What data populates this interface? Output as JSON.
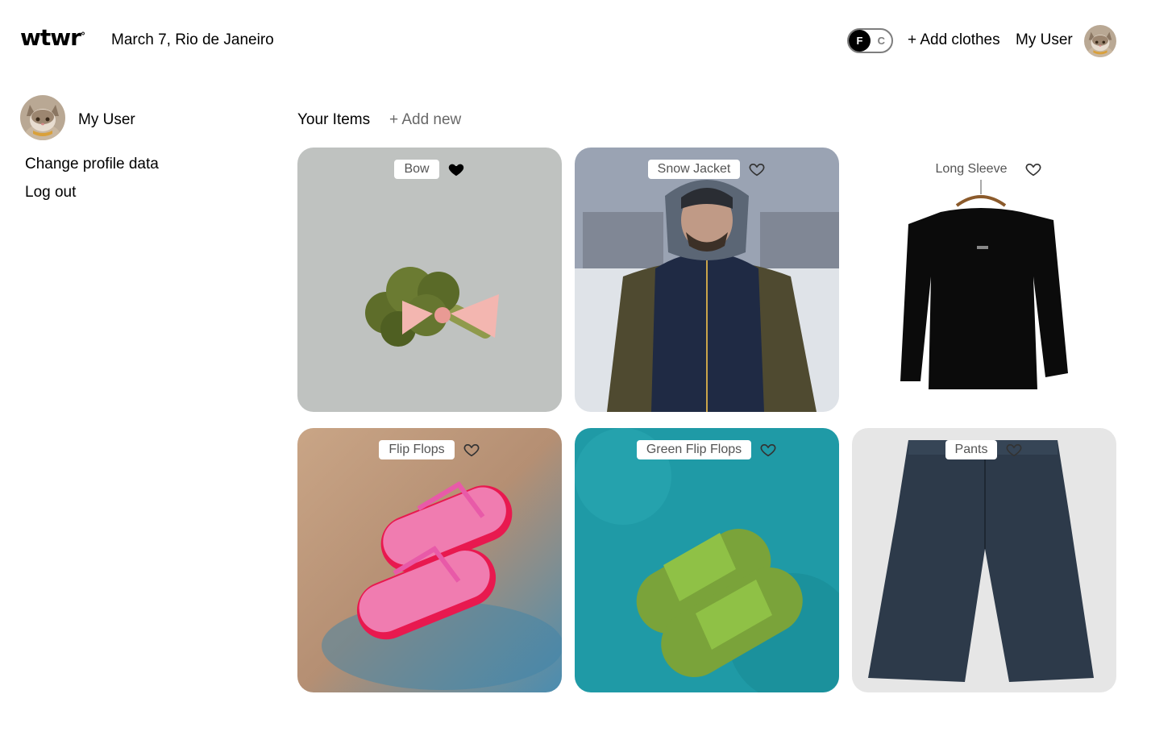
{
  "header": {
    "logo": "wtwr",
    "logo_mark": "°",
    "date_location": "March 7, Rio de Janeiro",
    "temp_toggle": {
      "active": "F",
      "inactive": "C"
    },
    "add_clothes_label": "+ Add clothes",
    "username": "My User"
  },
  "sidebar": {
    "username": "My User",
    "change_profile_label": "Change profile data",
    "logout_label": "Log out"
  },
  "items": {
    "title": "Your Items",
    "add_new_label": "+ Add new",
    "cards": [
      {
        "name": "Bow",
        "liked": true
      },
      {
        "name": "Snow Jacket",
        "liked": false
      },
      {
        "name": "Long Sleeve",
        "liked": false
      },
      {
        "name": "Flip Flops",
        "liked": false
      },
      {
        "name": "Green Flip Flops",
        "liked": false
      },
      {
        "name": "Pants",
        "liked": false
      }
    ]
  },
  "colors": {
    "text": "#000000",
    "muted": "#545454",
    "toggle_border": "#7e7e7e"
  },
  "icons": {
    "like_filled": "heart-filled-icon",
    "like_outline": "heart-outline-icon"
  }
}
